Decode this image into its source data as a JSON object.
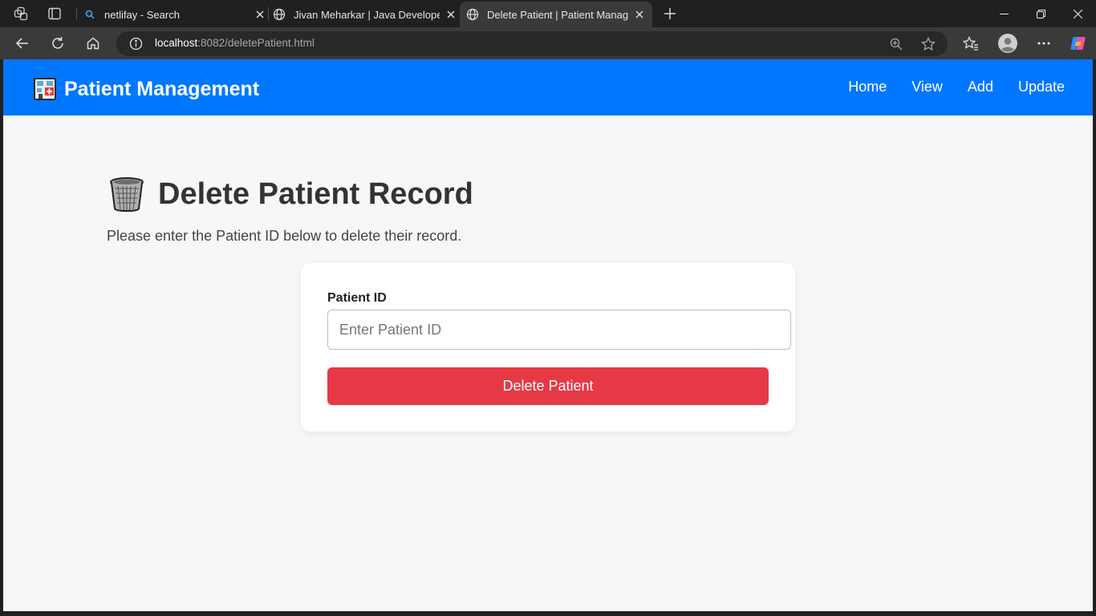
{
  "browser": {
    "tabs": [
      {
        "title": "netlifay - Search",
        "favicon": "search-icon"
      },
      {
        "title": "Jivan Meharkar | Java Developer",
        "favicon": "globe-icon"
      },
      {
        "title": "Delete Patient | Patient Management",
        "favicon": "globe-icon",
        "active": true
      }
    ],
    "url_host": "localhost",
    "url_rest": ":8082/deletePatient.html"
  },
  "header": {
    "brand_icon": "hospital-icon",
    "brand_name": "Patient Management",
    "nav": [
      "Home",
      "View",
      "Add",
      "Update"
    ]
  },
  "main": {
    "title_icon": "wastebasket-icon",
    "title": "Delete Patient Record",
    "subtitle": "Please enter the Patient ID below to delete their record.",
    "form": {
      "label": "Patient ID",
      "placeholder": "Enter Patient ID",
      "value": "",
      "submit_label": "Delete Patient"
    }
  },
  "colors": {
    "header_bg": "#0077ff",
    "page_bg": "#f6f7f9",
    "delete_button": "#e63946",
    "browser_chrome": "#202020"
  }
}
